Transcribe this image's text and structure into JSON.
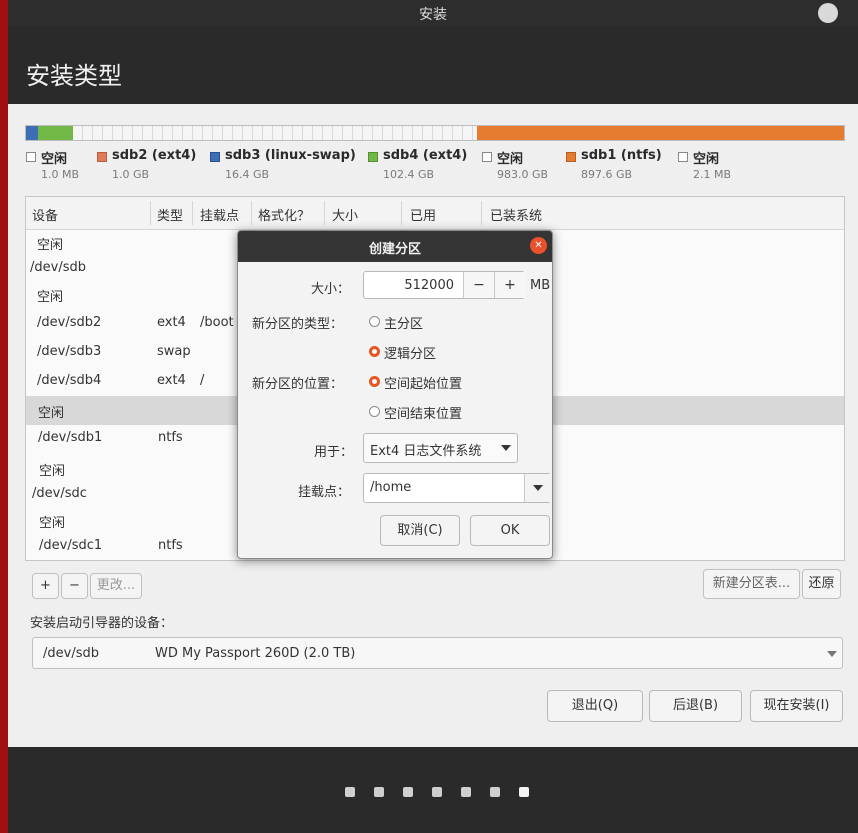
{
  "window": {
    "title": "安装"
  },
  "page": {
    "heading": "安装类型"
  },
  "partition_bar": {
    "segments": [
      {
        "color": "#3d6db5",
        "size_gb": 16.4
      },
      {
        "color": "#72b846",
        "size_gb": 102.4
      },
      {
        "color": "#f5f5f5",
        "size_gb": 983.0
      },
      {
        "color": "#e57c30",
        "size_gb": 897.6
      }
    ]
  },
  "legend": [
    {
      "label": "空闲",
      "size": "1.0 MB",
      "color": "#ffffff"
    },
    {
      "label": "sdb2 (ext4)",
      "size": "1.0 GB",
      "color": "#e07a5a"
    },
    {
      "label": "sdb3 (linux-swap)",
      "size": "16.4 GB",
      "color": "#3d6db5"
    },
    {
      "label": "sdb4 (ext4)",
      "size": "102.4 GB",
      "color": "#72b846"
    },
    {
      "label": "空闲",
      "size": "983.0 GB",
      "color": "#ffffff"
    },
    {
      "label": "sdb1 (ntfs)",
      "size": "897.6 GB",
      "color": "#e57c30"
    },
    {
      "label": "空闲",
      "size": "2.1 MB",
      "color": "#ffffff"
    }
  ],
  "table": {
    "columns": [
      "设备",
      "类型",
      "挂载点",
      "格式化？",
      "大小",
      "已用",
      "已装系统"
    ],
    "rows": [
      {
        "device": "空闲",
        "type": "",
        "mount": ""
      },
      {
        "device": "/dev/sdb",
        "type": "",
        "mount": ""
      },
      {
        "device": "空闲",
        "type": "",
        "mount": ""
      },
      {
        "device": "/dev/sdb2",
        "type": "ext4",
        "mount": "/boot"
      },
      {
        "device": "/dev/sdb3",
        "type": "swap",
        "mount": ""
      },
      {
        "device": "/dev/sdb4",
        "type": "ext4",
        "mount": "/"
      },
      {
        "device": "空闲",
        "type": "",
        "mount": ""
      },
      {
        "device": "/dev/sdb1",
        "type": "ntfs",
        "mount": ""
      },
      {
        "device": "空闲",
        "type": "",
        "mount": ""
      },
      {
        "device": "/dev/sdc",
        "type": "",
        "mount": ""
      },
      {
        "device": "空闲",
        "type": "",
        "mount": ""
      },
      {
        "device": "/dev/sdc1",
        "type": "ntfs",
        "mount": ""
      }
    ]
  },
  "toolbar": {
    "add": "+",
    "remove": "−",
    "change": "更改...",
    "new_table": "新建分区表...",
    "revert": "还原"
  },
  "boot": {
    "label": "安装启动引导器的设备：",
    "device": "/dev/sdb",
    "desc": "WD My Passport 260D (2.0 TB)"
  },
  "buttons": {
    "quit": "退出(Q)",
    "back": "后退(B)",
    "install": "现在安装(I)"
  },
  "progress": {
    "total_steps": 7
  },
  "dialog": {
    "title": "创建分区",
    "size_label": "大小：",
    "size_value": "512000",
    "minus": "−",
    "plus": "+",
    "unit": "MB",
    "type_label": "新分区的类型：",
    "type_primary": "主分区",
    "type_logical": "逻辑分区",
    "location_label": "新分区的位置：",
    "loc_start": "空间起始位置",
    "loc_end": "空间结束位置",
    "use_label": "用于：",
    "use_value": "Ext4 日志文件系统",
    "mount_label": "挂载点：",
    "mount_value": "/home",
    "cancel": "取消(C)",
    "ok": "OK"
  }
}
